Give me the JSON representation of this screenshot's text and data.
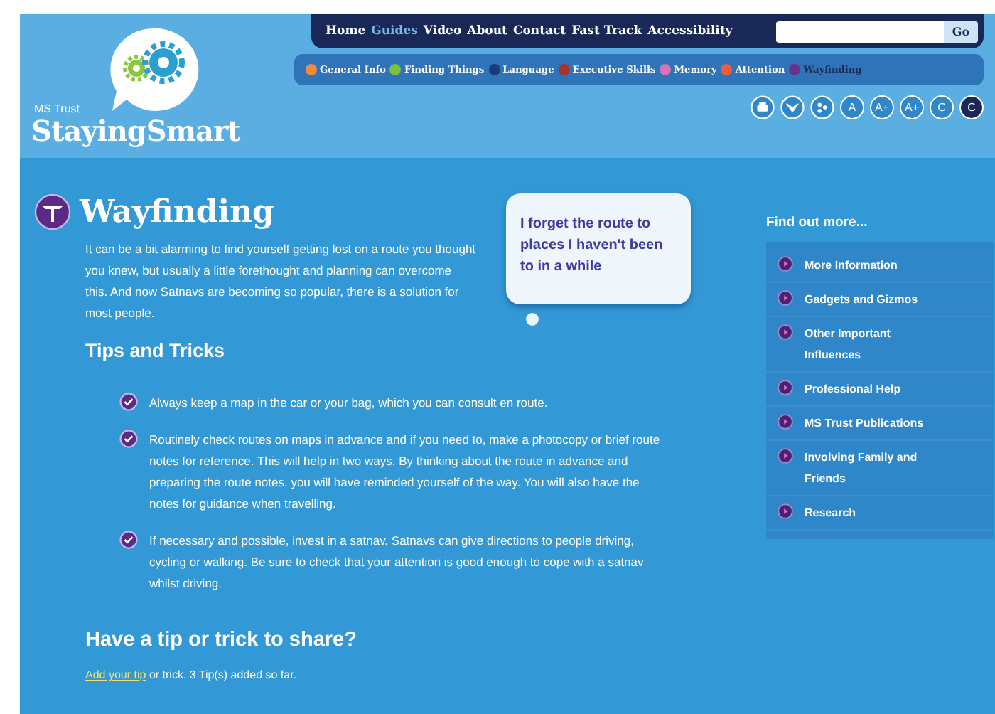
{
  "logo": {
    "org": "MS Trust",
    "name": "StayingSmart"
  },
  "nav": [
    {
      "label": "Home",
      "selected": false
    },
    {
      "label": "Guides",
      "selected": true
    },
    {
      "label": "Video",
      "selected": false
    },
    {
      "label": "About",
      "selected": false
    },
    {
      "label": "Contact",
      "selected": false
    },
    {
      "label": "Fast Track",
      "selected": false
    },
    {
      "label": "Accessibility",
      "selected": false
    }
  ],
  "search": {
    "button": "Go"
  },
  "guides": [
    {
      "label": "General Info",
      "color": "#f08a3c",
      "selected": false
    },
    {
      "label": "Finding Things",
      "color": "#7cc043",
      "selected": false
    },
    {
      "label": "Language",
      "color": "#1d3a7a",
      "selected": false
    },
    {
      "label": "Executive Skills",
      "color": "#a8322c",
      "selected": false
    },
    {
      "label": "Memory",
      "color": "#d774b8",
      "selected": false
    },
    {
      "label": "Attention",
      "color": "#e8603c",
      "selected": false
    },
    {
      "label": "Wayfinding",
      "color": "#6a3090",
      "selected": true
    }
  ],
  "tools": [
    {
      "kind": "icon"
    },
    {
      "kind": "icon"
    },
    {
      "kind": "icon"
    },
    {
      "kind": "text",
      "label": "A",
      "selected": false
    },
    {
      "kind": "text",
      "label": "A+",
      "selected": false
    },
    {
      "kind": "text",
      "label": "A+",
      "selected": false
    },
    {
      "kind": "text",
      "label": "C",
      "selected": false
    },
    {
      "kind": "text",
      "label": "C",
      "selected": true
    }
  ],
  "page": {
    "title": "Wayfinding",
    "intro": "It can be a bit alarming to find yourself getting lost on a route you thought you knew, but usually a little forethought and planning can overcome this. And now Satnavs are becoming so popular, there is a solution for most people.",
    "quote": "I forget the route to places I haven't been to in a while"
  },
  "tips": {
    "heading": "Tips and Tricks",
    "items": [
      "Always keep a map in the car or your bag, which you can consult en route.",
      "Routinely check routes on maps in advance and if you need to, make a photocopy or brief route notes for reference. This will help in two ways. By thinking about the route in advance and preparing the route notes, you will have reminded yourself of the way. You will also have the notes for guidance when travelling.",
      "If necessary and possible, invest in a satnav. Satnavs can give directions to people driving, cycling or walking. Be sure to check that your attention is good enough to cope with a satnav whilst driving."
    ]
  },
  "share": {
    "heading": "Have a tip or trick to share?",
    "link": "Add your tip",
    "text": "or trick. 3 Tip(s) added so far."
  },
  "sidebar": {
    "heading": "Find out more...",
    "items": [
      "More Information",
      "Gadgets and Gizmos",
      "Other Important Influences",
      "Professional Help",
      "MS Trust Publications",
      "Involving Family and Friends",
      "Research"
    ]
  }
}
